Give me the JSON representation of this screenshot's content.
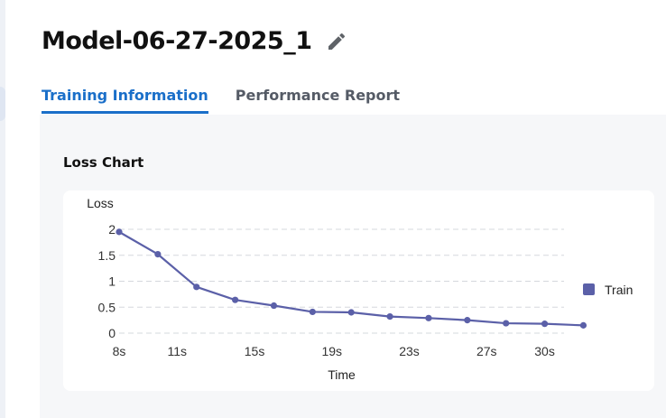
{
  "page": {
    "title": "Model-06-27-2025_1",
    "edit_icon": "pencil-icon"
  },
  "tabs": [
    {
      "label": "Training Information",
      "active": true
    },
    {
      "label": "Performance Report",
      "active": false
    }
  ],
  "section": {
    "title": "Loss Chart"
  },
  "colors": {
    "accent": "#1a6fc9",
    "series": "#5b60a8",
    "grid": "#d5d8dd",
    "background": "#f6f7f9"
  },
  "chart_data": {
    "type": "line",
    "title": "",
    "xlabel": "Time",
    "ylabel": "Loss",
    "x": [
      8,
      10,
      12,
      14,
      16,
      18,
      20,
      22,
      24,
      26,
      28,
      30,
      32
    ],
    "xticks": [
      8,
      11,
      15,
      19,
      23,
      27,
      30
    ],
    "xtick_labels": [
      "8s",
      "11s",
      "15s",
      "19s",
      "23s",
      "27s",
      "30s"
    ],
    "yticks": [
      0,
      0.5,
      1,
      1.5,
      2
    ],
    "ytick_labels": [
      "0",
      "0.5",
      "1",
      "1.5",
      "2"
    ],
    "xlim": [
      8,
      31
    ],
    "ylim": [
      0,
      2
    ],
    "grid": "horizontal-dashed",
    "legend_position": "right",
    "series": [
      {
        "name": "Train",
        "values": [
          1.95,
          1.52,
          0.89,
          0.64,
          0.53,
          0.41,
          0.4,
          0.32,
          0.29,
          0.25,
          0.19,
          0.18,
          0.15
        ]
      }
    ]
  }
}
